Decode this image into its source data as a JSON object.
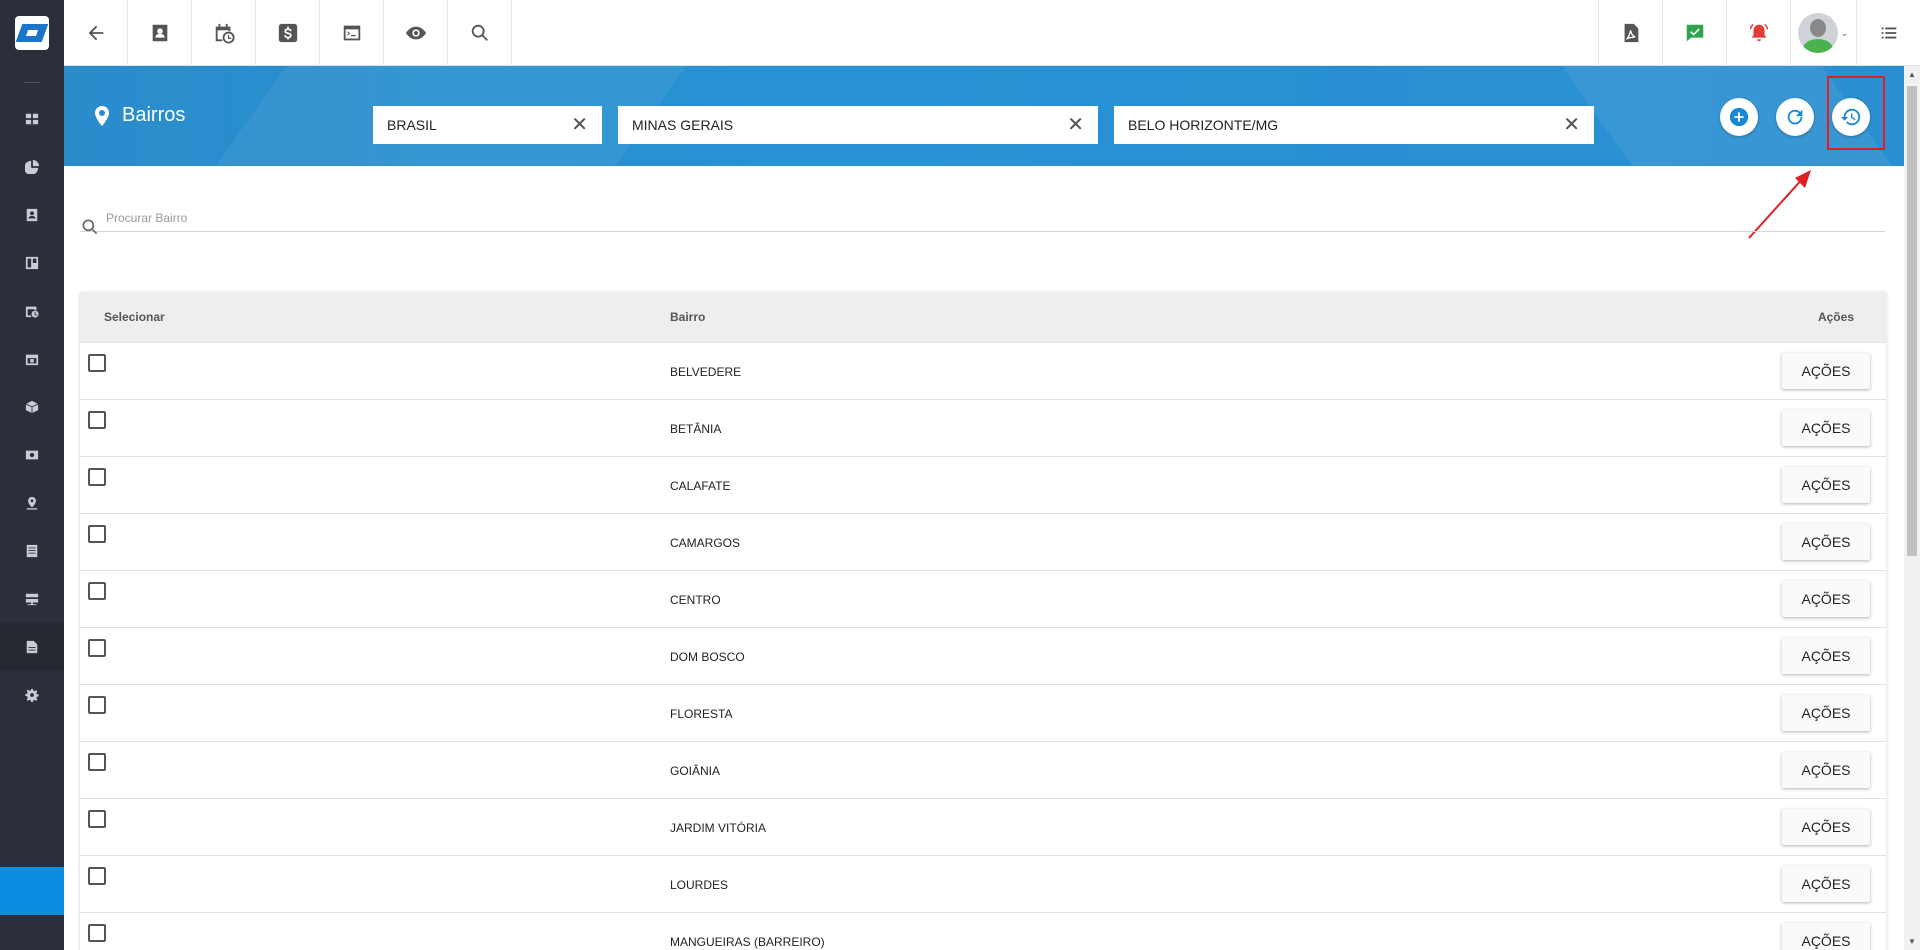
{
  "header": {
    "title": "Bairros",
    "filters": [
      {
        "value": "BRASIL"
      },
      {
        "value": "MINAS GERAIS"
      },
      {
        "value": "BELO HORIZONTE/MG"
      }
    ]
  },
  "search": {
    "placeholder": "Procurar Bairro"
  },
  "table": {
    "headers": {
      "select": "Selecionar",
      "bairro": "Bairro",
      "actions": "Ações"
    },
    "action_label": "AÇÕES",
    "rows": [
      {
        "name": "BELVEDERE"
      },
      {
        "name": "BETÂNIA"
      },
      {
        "name": "CALAFATE"
      },
      {
        "name": "CAMARGOS"
      },
      {
        "name": "CENTRO"
      },
      {
        "name": "DOM BOSCO"
      },
      {
        "name": "FLORESTA"
      },
      {
        "name": "GOIÂNIA"
      },
      {
        "name": "JARDIM VITÓRIA"
      },
      {
        "name": "LOURDES"
      },
      {
        "name": "MANGUEIRAS (BARREIRO)"
      }
    ]
  },
  "colors": {
    "accent": "#2792d4",
    "sidebar": "#2b2f3a",
    "highlight": "#e02020"
  }
}
